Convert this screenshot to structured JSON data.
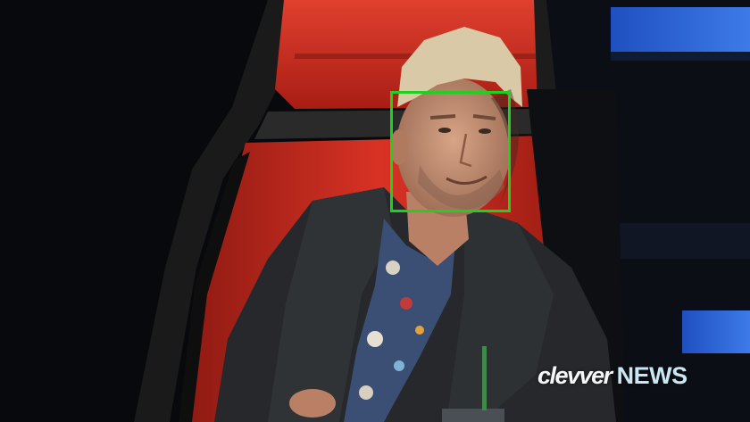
{
  "watermark": {
    "brand": "clevver",
    "section": "NEWS"
  },
  "detection": {
    "label": "face",
    "color": "#1fd11f"
  },
  "colors": {
    "chair_red": "#c8281c",
    "chair_dark": "#151515",
    "jacket": "#2a2c2e",
    "background": "#07090d",
    "stage_blue": "#2e63d8"
  }
}
